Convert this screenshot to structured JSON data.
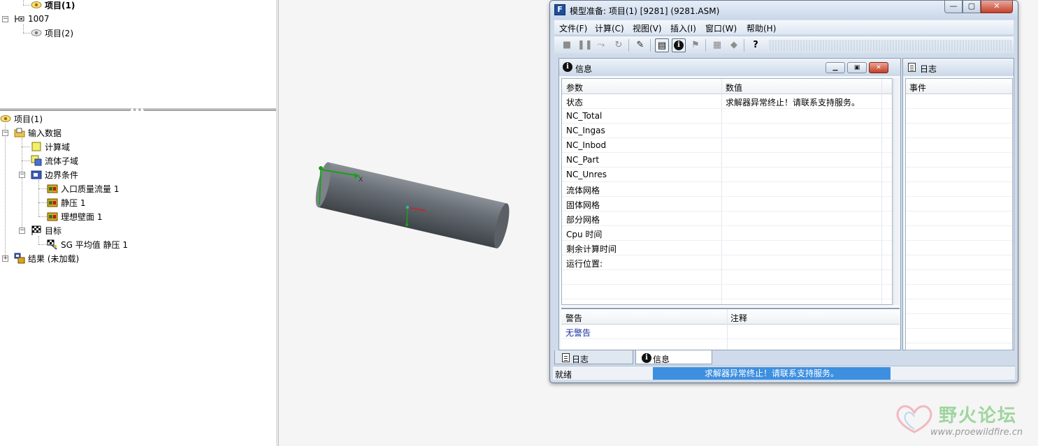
{
  "tree_top": {
    "items": [
      {
        "label": "项目(1)",
        "bold": true
      },
      {
        "label": "1007",
        "bold": false
      },
      {
        "label": "项目(2)",
        "bold": false
      }
    ]
  },
  "tree_bottom": {
    "root": "项目(1)",
    "input_data": "输入数据",
    "compute_domain": "计算域",
    "fluid_subdomain": "流体子域",
    "boundary_conditions": "边界条件",
    "bc_items": [
      "入口质量流量 1",
      "静压 1",
      "理想壁面 1"
    ],
    "goals": "目标",
    "goal_items": [
      "SG 平均值 静压 1"
    ],
    "results": "结果 (未加载)"
  },
  "viewport": {
    "axis_label": "X"
  },
  "dialog": {
    "app_icon": "F",
    "title": "模型准备: 项目(1) [9281] (9281.ASM)",
    "caption": {
      "minimize": "—",
      "maximize": "▢",
      "close": "✕"
    },
    "menu": [
      "文件(F)",
      "计算(C)",
      "视图(V)",
      "插入(I)",
      "窗口(W)",
      "帮助(H)"
    ],
    "toolbar_icons": [
      "stop-icon",
      "pause-icon",
      "solve-icon",
      "refresh-icon",
      "pin-icon",
      "document-icon",
      "info-icon",
      "flag-icon",
      "mesh-icon",
      "diamond-icon",
      "help-icon"
    ],
    "info": {
      "title": "信息",
      "col_param": "参数",
      "col_value": "数值",
      "rows": [
        {
          "param": "状态",
          "value": "求解器异常终止！请联系支持服务。"
        },
        {
          "param": "NC_Total",
          "value": ""
        },
        {
          "param": "NC_Ingas",
          "value": ""
        },
        {
          "param": "NC_Inbod",
          "value": ""
        },
        {
          "param": "NC_Part",
          "value": ""
        },
        {
          "param": "NC_Unres",
          "value": ""
        },
        {
          "param": "流体网格",
          "value": ""
        },
        {
          "param": "固体网格",
          "value": ""
        },
        {
          "param": "部分网格",
          "value": ""
        },
        {
          "param": "Cpu 时间",
          "value": ""
        },
        {
          "param": "剩余计算时间",
          "value": ""
        },
        {
          "param": "运行位置:",
          "value": ""
        }
      ],
      "warn_col": "警告",
      "note_col": "注释",
      "warn_value": "无警告",
      "warn_color": "#1a2fa0"
    },
    "log": {
      "title": "日志",
      "col_event": "事件"
    },
    "tabs": [
      "日志",
      "信息"
    ],
    "status": {
      "ready": "就绪",
      "progress_text": "求解器异常终止！请联系支持服务。",
      "progress_color": "#3d8fe0"
    }
  },
  "watermark": {
    "title": "野火论坛",
    "url": "www.proewildfire.cn"
  }
}
